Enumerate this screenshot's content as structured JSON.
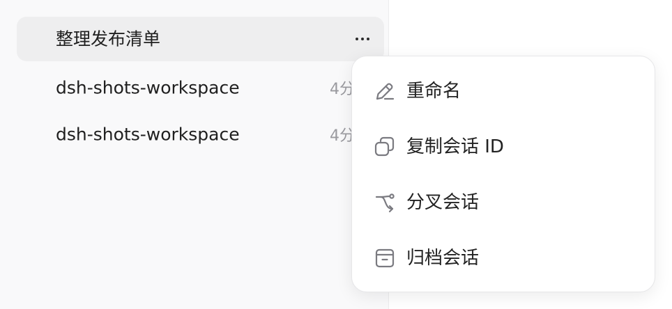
{
  "sidebar": {
    "conversations": [
      {
        "title": "整理发布清单",
        "time": ""
      },
      {
        "title": "dsh-shots-workspace",
        "time": "4分"
      },
      {
        "title": "dsh-shots-workspace",
        "time": "4分"
      }
    ],
    "more_icon": "more-horizontal-icon"
  },
  "context_menu": {
    "items": [
      {
        "label": "重命名",
        "icon": "pencil-icon"
      },
      {
        "label": "复制会话 ID",
        "icon": "copy-icon"
      },
      {
        "label": "分叉会话",
        "icon": "fork-icon"
      },
      {
        "label": "归档会话",
        "icon": "archive-icon"
      }
    ]
  },
  "colors": {
    "sidebar_bg": "#f9f9fa",
    "active_row": "#eeeeef",
    "muted_text": "#9a9a9f",
    "icon_stroke": "#7a7a80"
  }
}
